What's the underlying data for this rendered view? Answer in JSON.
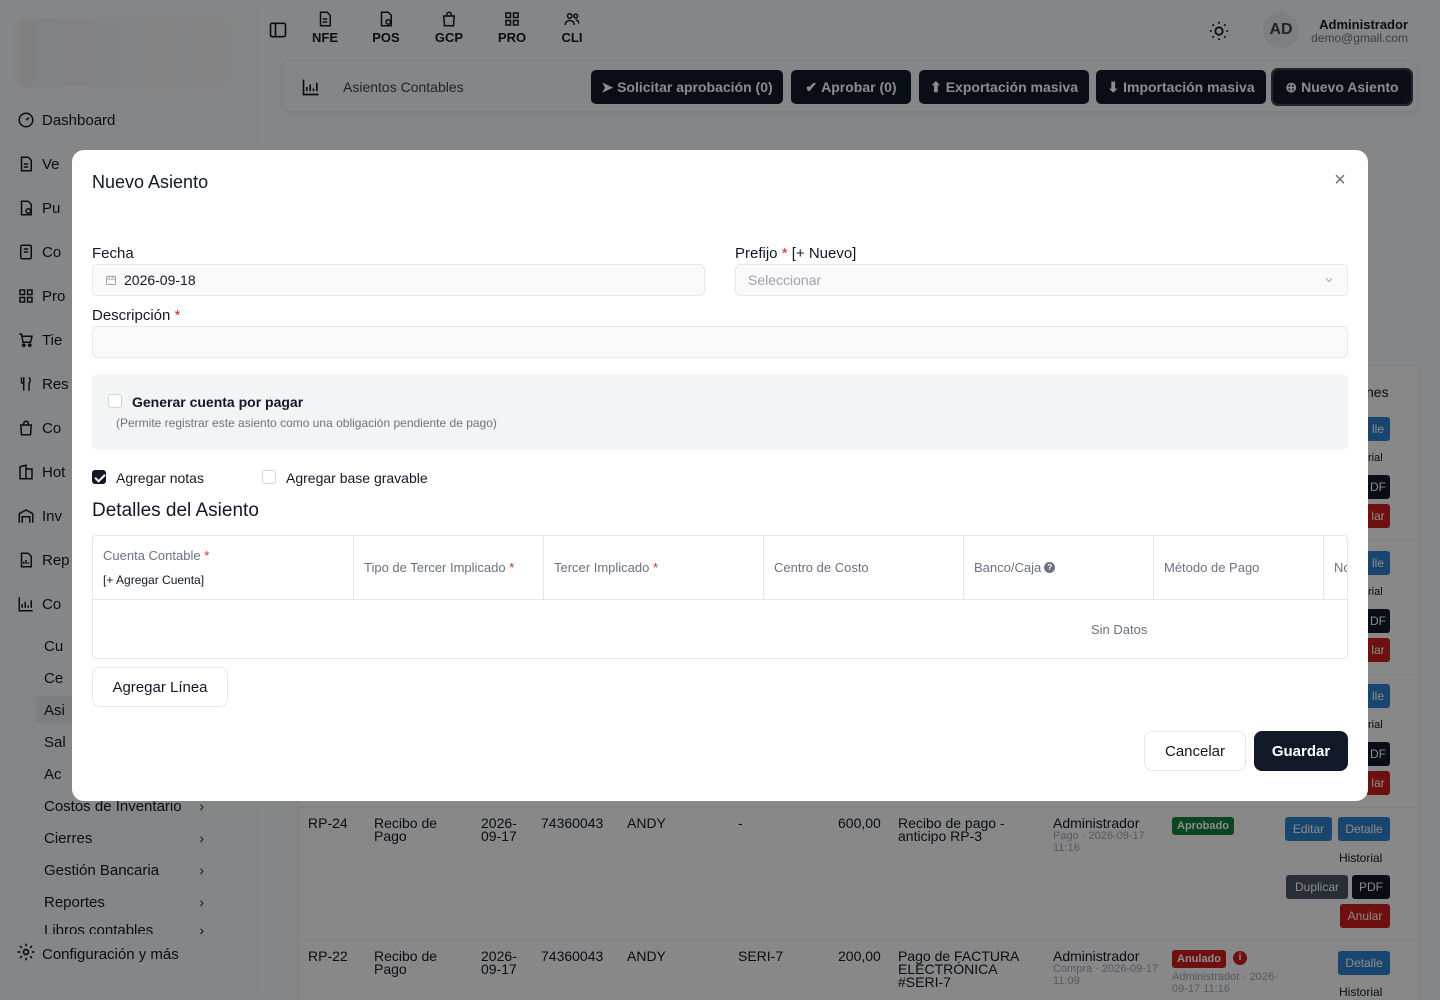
{
  "sidebar": {
    "items": [
      {
        "label": "Dashboard",
        "icon": "gauge-icon"
      },
      {
        "label": "Ve",
        "icon": "document-icon"
      },
      {
        "label": "Pu",
        "icon": "receipt-icon"
      },
      {
        "label": "Co",
        "icon": "invoice-icon"
      },
      {
        "label": "Pro",
        "icon": "grid-icon"
      },
      {
        "label": "Tie",
        "icon": "cart-icon"
      },
      {
        "label": "Res",
        "icon": "fork-knife-icon"
      },
      {
        "label": "Co",
        "icon": "bag-icon"
      },
      {
        "label": "Hot",
        "icon": "building-icon"
      },
      {
        "label": "Inv",
        "icon": "warehouse-icon"
      },
      {
        "label": "Rep",
        "icon": "report-icon"
      },
      {
        "label": "Co",
        "icon": "chart-icon"
      }
    ],
    "sub_items": [
      "Cu",
      "Ce",
      "Asi",
      "Sal",
      "Ac",
      "Costos de Inventario",
      "Cierres",
      "Gestión Bancaria",
      "Reportes",
      "Libros contables"
    ],
    "config_label": "Configuración y más"
  },
  "topbar": {
    "modules": [
      "NFE",
      "POS",
      "GCP",
      "PRO",
      "CLI"
    ],
    "avatar_initials": "AD",
    "user_name": "Administrador",
    "user_email": "demo@gmail.com"
  },
  "header": {
    "title": "Asientos Contables",
    "buttons": {
      "request_approval": "Solicitar aprobación (0)",
      "approve": "Aprobar (0)",
      "bulk_export": "Exportación masiva",
      "bulk_import": "Importación masiva",
      "new_entry": "Nuevo Asiento"
    }
  },
  "background_table": {
    "actions_header_fragment": "nes",
    "side_button_fragments": {
      "detail": "lle",
      "history": "rial",
      "pdf": "DF",
      "cancel": "lar"
    },
    "rows": [
      {
        "code": "RP-24",
        "type": "Recibo de Pago",
        "date": "2026-09-17",
        "nit": "74360043",
        "name": "ANDY",
        "ref": "-",
        "amount": "600,00",
        "description": "Recibo de pago - anticipo RP-3",
        "user": "Administrador",
        "user_sub": "Pago · 2026-09-17 11:16",
        "status": "Aprobado",
        "actions": {
          "edit": "Editar",
          "detail": "Detalle",
          "history": "Historial",
          "duplicate": "Duplicar",
          "pdf": "PDF",
          "cancel": "Anular"
        }
      },
      {
        "code": "RP-22",
        "type": "Recibo de Pago",
        "date": "2026-09-17",
        "nit": "74360043",
        "name": "ANDY",
        "ref": "SERI-7",
        "amount": "200,00",
        "description": "Pago de FACTURA ELECTRÓNICA #SERI-7",
        "user": "Administrador",
        "user_sub": "Compra · 2026-09-17 11:09",
        "status": "Anulado",
        "status_sub": "Administrador · 2026-09-17 11:16",
        "actions": {
          "detail": "Detalle",
          "history": "Historial"
        }
      }
    ]
  },
  "modal": {
    "title": "Nuevo Asiento",
    "fecha_label": "Fecha",
    "fecha_value": "2026-09-18",
    "prefijo_label": "Prefijo",
    "prefijo_new": "[+ Nuevo]",
    "prefijo_placeholder": "Seleccionar",
    "descripcion_label": "Descripción",
    "descripcion_value": "",
    "cxp_label": "Generar cuenta por pagar",
    "cxp_hint": "(Permite registrar este asiento como una obligación pendiente de pago)",
    "cxp_checked": false,
    "notes_label": "Agregar notas",
    "notes_checked": true,
    "base_label": "Agregar base gravable",
    "base_checked": false,
    "details_title": "Detalles del Asiento",
    "columns": {
      "account": "Cuenta Contable",
      "account_add": "[+ Agregar Cuenta]",
      "third_type": "Tipo de Tercer Implicado",
      "third": "Tercer Implicado",
      "cost_center": "Centro de Costo",
      "bank": "Banco/Caja",
      "payment_method": "Método de Pago",
      "next_fragment": "No"
    },
    "required_mark": "*",
    "empty_text": "Sin Datos",
    "add_line": "Agregar Línea",
    "cancel": "Cancelar",
    "save": "Guardar"
  },
  "colors": {
    "primary": "#111827",
    "danger": "#c81e1e",
    "info": "#2f80c8",
    "success": "#15803d"
  }
}
